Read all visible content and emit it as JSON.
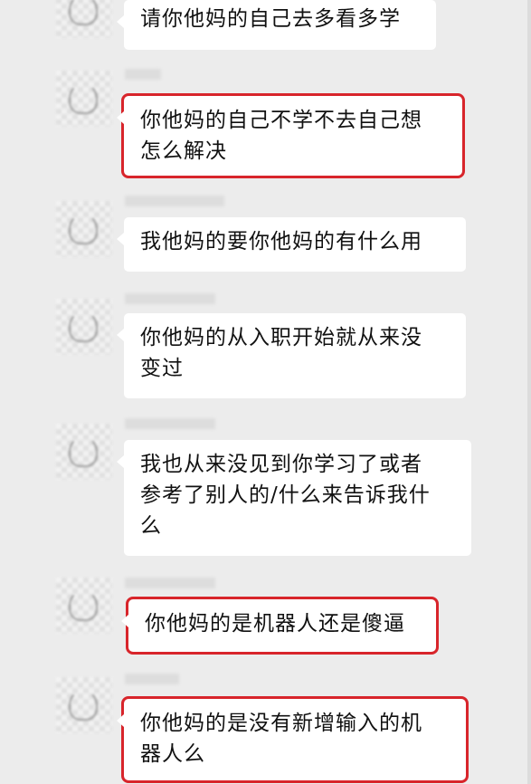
{
  "chat": {
    "messages": [
      {
        "text": "请你他妈的自己去多看多学",
        "highlighted": false
      },
      {
        "text": "你他妈的自己不学不去自己想\n怎么解决",
        "highlighted": true
      },
      {
        "text": "我他妈的要你他妈的有什么用",
        "highlighted": false
      },
      {
        "text": "你他妈的从入职开始就从来没\n变过",
        "highlighted": false
      },
      {
        "text": "我也从来没见到你学习了或者\n参考了别人的/什么来告诉我什\n么",
        "highlighted": false
      },
      {
        "text": "你他妈的是机器人还是傻逼",
        "highlighted": true
      },
      {
        "text": "你他妈的是没有新增输入的机\n器人么",
        "highlighted": true
      }
    ]
  },
  "colors": {
    "background": "#ececec",
    "bubble": "#ffffff",
    "highlight_border": "#d8252b",
    "text": "#111111"
  }
}
